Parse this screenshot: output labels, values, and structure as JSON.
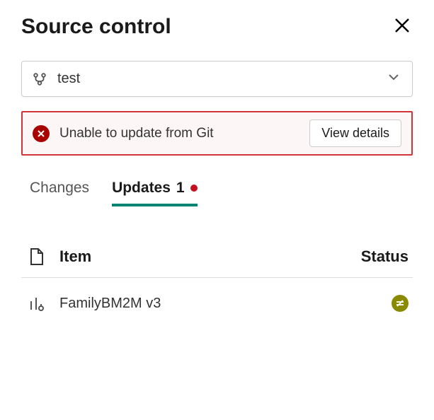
{
  "header": {
    "title": "Source control"
  },
  "branch": {
    "name": "test"
  },
  "error": {
    "message": "Unable to update from Git",
    "action_label": "View details"
  },
  "tabs": {
    "changes_label": "Changes",
    "updates_label": "Updates",
    "updates_count": "1"
  },
  "columns": {
    "item": "Item",
    "status": "Status"
  },
  "rows": [
    {
      "name": "FamilyBM2M v3"
    }
  ]
}
